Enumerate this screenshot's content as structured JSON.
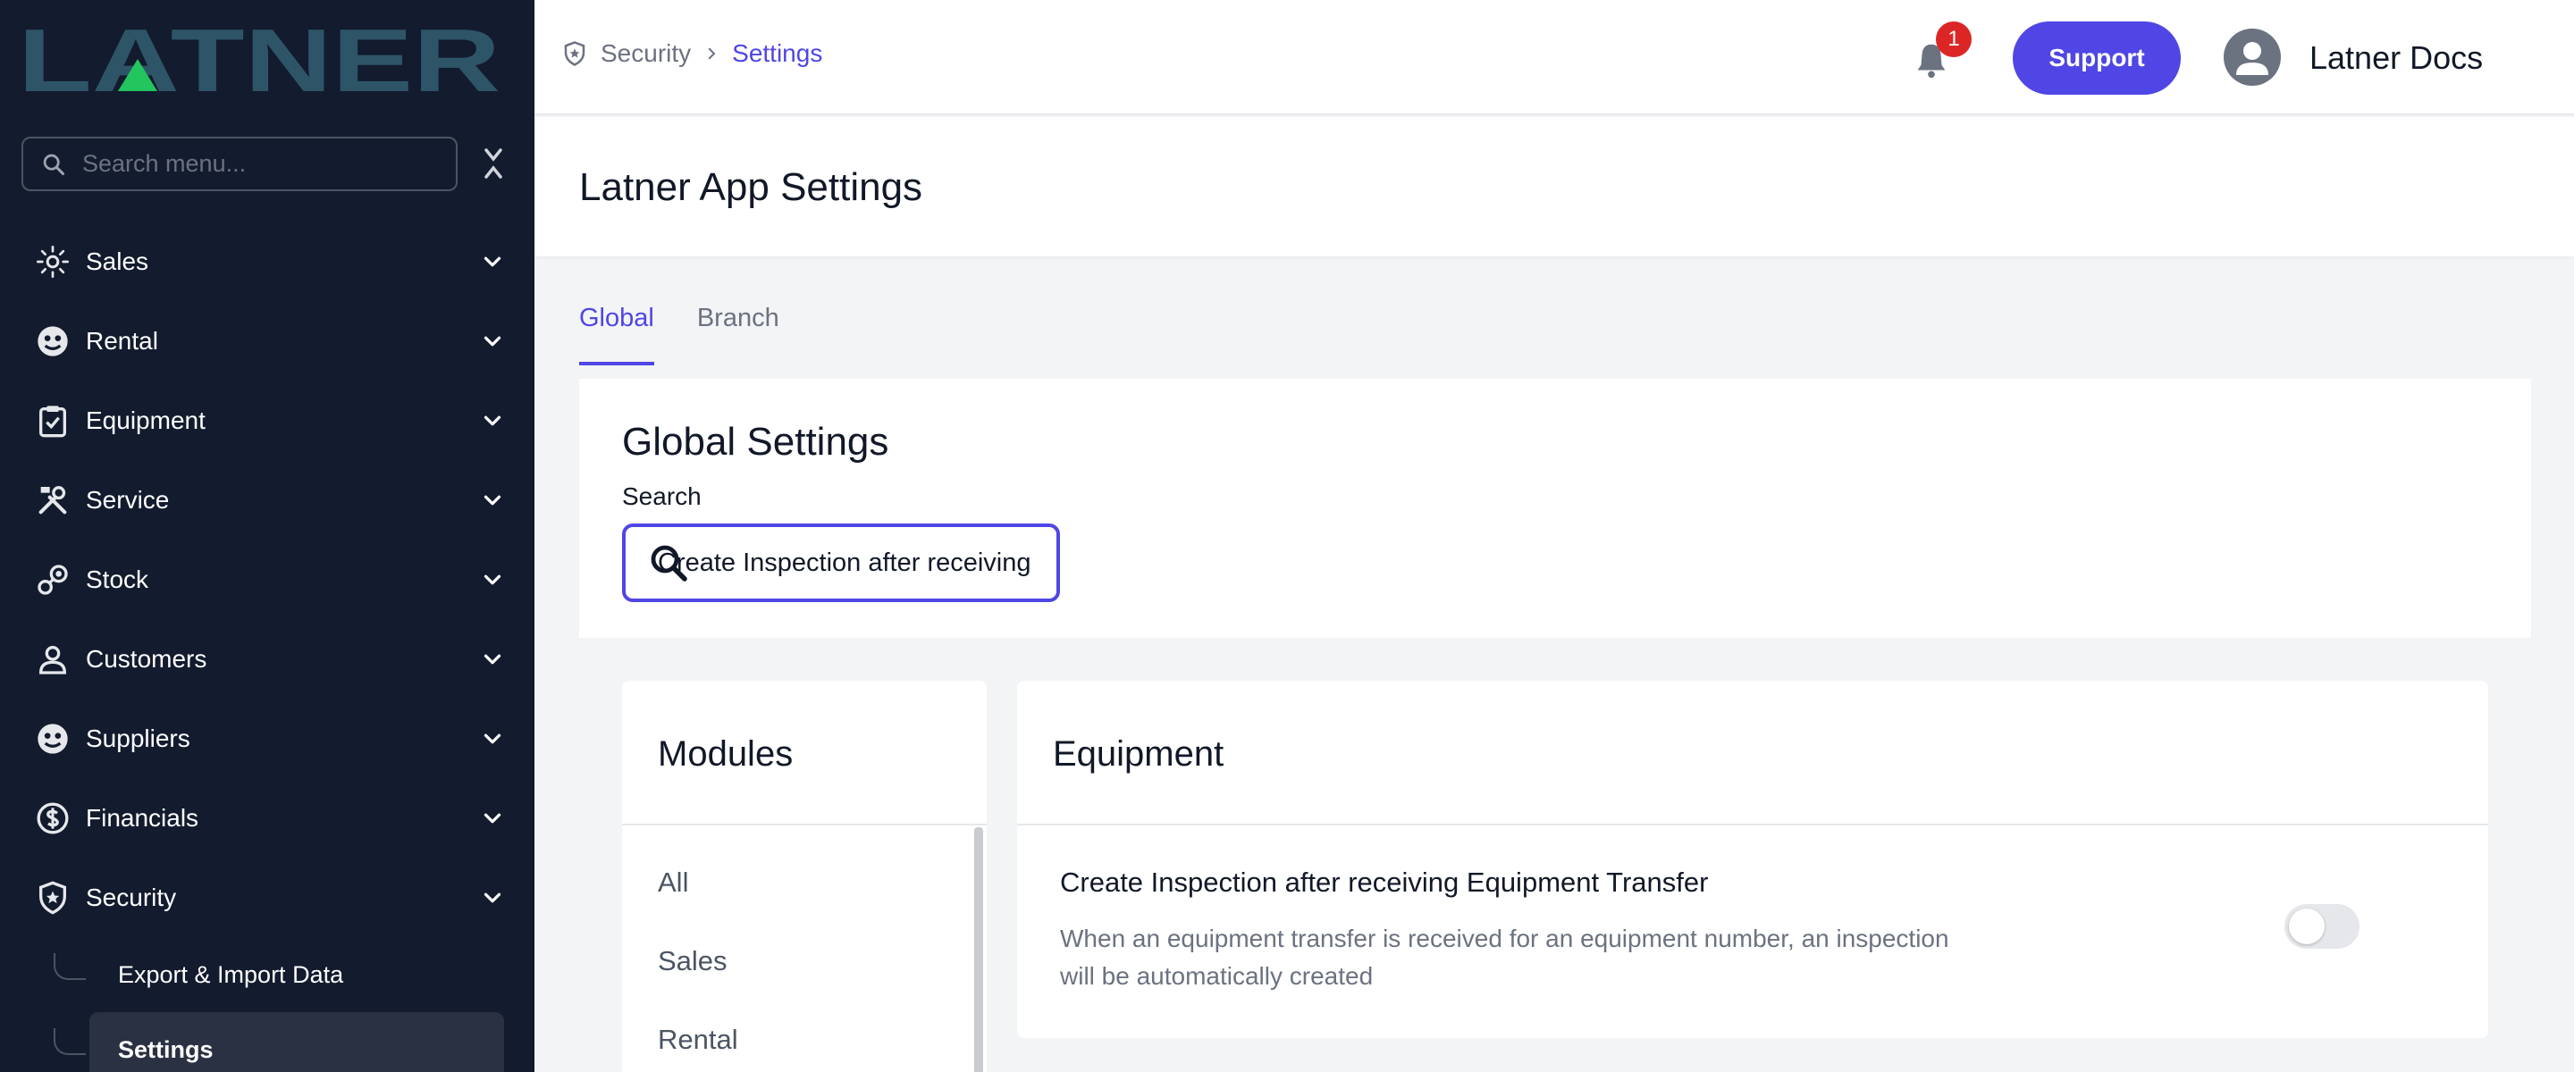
{
  "brand": {
    "logo_text": "LATNER"
  },
  "sidebar": {
    "search_placeholder": "Search menu...",
    "items": [
      {
        "label": "Sales",
        "icon": "sales-icon"
      },
      {
        "label": "Rental",
        "icon": "rental-icon"
      },
      {
        "label": "Equipment",
        "icon": "clipboard-icon"
      },
      {
        "label": "Service",
        "icon": "tools-icon"
      },
      {
        "label": "Stock",
        "icon": "stock-icon"
      },
      {
        "label": "Customers",
        "icon": "user-icon"
      },
      {
        "label": "Suppliers",
        "icon": "supplier-icon"
      },
      {
        "label": "Financials",
        "icon": "dollar-icon"
      },
      {
        "label": "Security",
        "icon": "shield-icon"
      }
    ],
    "security_subitems": [
      {
        "label": "Export & Import Data",
        "active": false
      },
      {
        "label": "Settings",
        "active": true
      }
    ]
  },
  "topbar": {
    "breadcrumb": [
      "Security",
      "Settings"
    ],
    "notification_count": "1",
    "support_label": "Support",
    "user_name": "Latner Docs"
  },
  "page": {
    "title": "Latner App Settings"
  },
  "tabs": [
    {
      "label": "Global",
      "active": true
    },
    {
      "label": "Branch",
      "active": false
    }
  ],
  "global_settings": {
    "title": "Global Settings",
    "search_label": "Search",
    "search_value": "Create Inspection after receiving"
  },
  "modules": {
    "title": "Modules",
    "items": [
      "All",
      "Sales",
      "Rental"
    ]
  },
  "equipment": {
    "title": "Equipment",
    "setting": {
      "title": "Create Inspection after receiving Equipment Transfer",
      "description": "When an equipment transfer is received for an equipment number, an inspection will be automatically created",
      "enabled": false
    }
  },
  "colors": {
    "accent": "#4f46e5",
    "sidebar_bg": "#131b2e",
    "logo": "#2e5468",
    "logo_triangle": "#22c55e",
    "badge": "#dc2626"
  }
}
